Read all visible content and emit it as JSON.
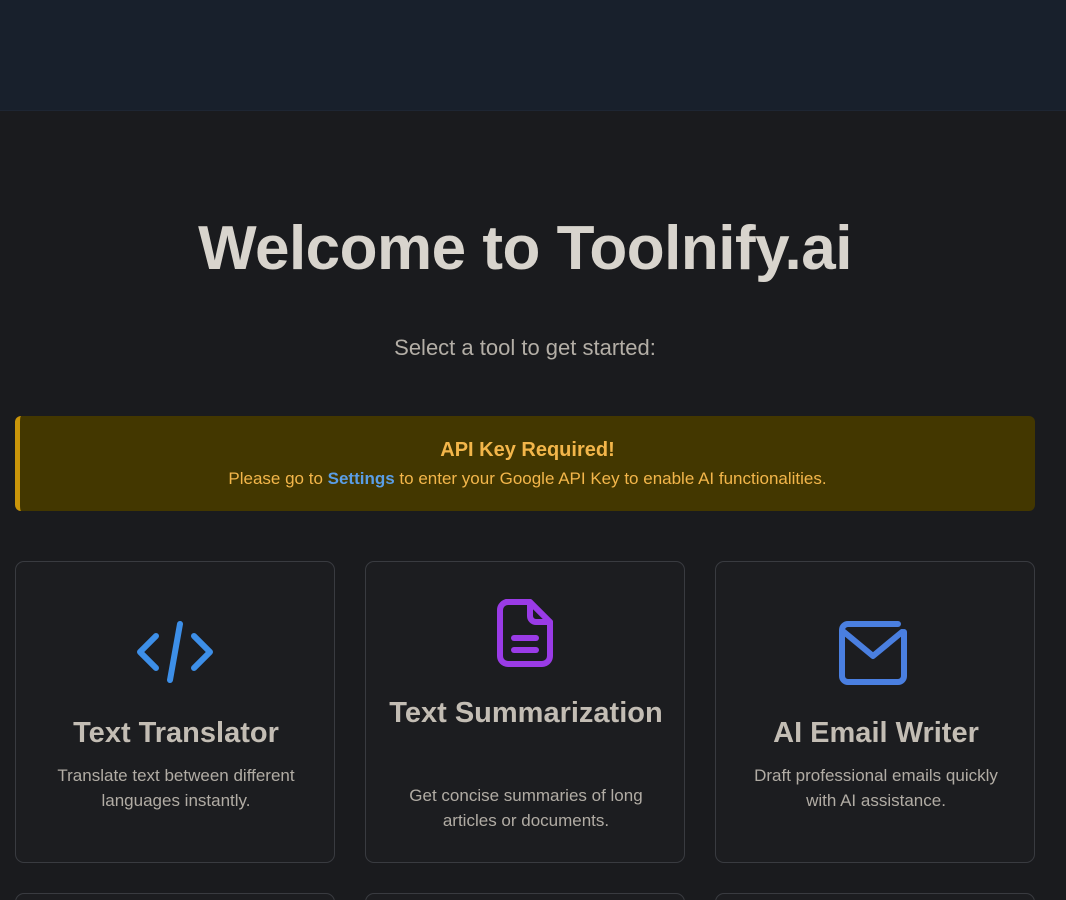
{
  "hero": {
    "title": "Welcome to Toolnify.ai",
    "subtitle": "Select a tool to get started:"
  },
  "alert": {
    "title": "API Key Required!",
    "text_before": "Please go to ",
    "link": "Settings",
    "text_after": " to enter your Google API Key to enable AI functionalities."
  },
  "tools": [
    {
      "title": "Text Translator",
      "description": "Translate text between different languages instantly.",
      "icon": "code-icon",
      "color": "#3d8fe8"
    },
    {
      "title": "Text Summarization",
      "description": "Get concise summaries of long articles or documents.",
      "icon": "document-icon",
      "color": "#9a3be6"
    },
    {
      "title": "AI Email Writer",
      "description": "Draft professional emails quickly with AI assistance.",
      "icon": "envelope-icon",
      "color": "#4a7fe0"
    }
  ],
  "colors": {
    "background": "#1a1b1e",
    "topbar": "#18202c",
    "alert_bg": "#433700",
    "alert_text": "#f3b64a",
    "link": "#5a9ee6"
  }
}
